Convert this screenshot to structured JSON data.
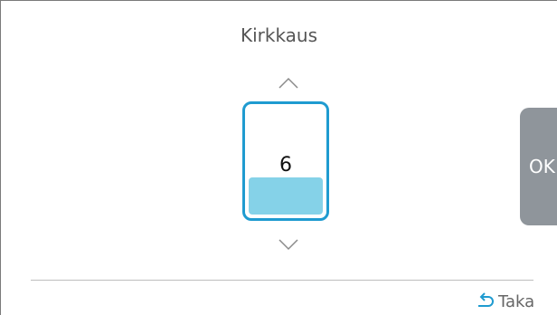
{
  "screen": {
    "title": "Kirkkaus"
  },
  "brightness": {
    "value": "6",
    "level_fraction": 0.35,
    "increase_icon": "chevron-up-icon",
    "decrease_icon": "chevron-down-icon",
    "accent_color": "#1f9bd0",
    "fill_color": "#85d2e8"
  },
  "actions": {
    "ok_label": "OK",
    "back_label": "Taka",
    "back_icon": "back-arrow-icon"
  }
}
